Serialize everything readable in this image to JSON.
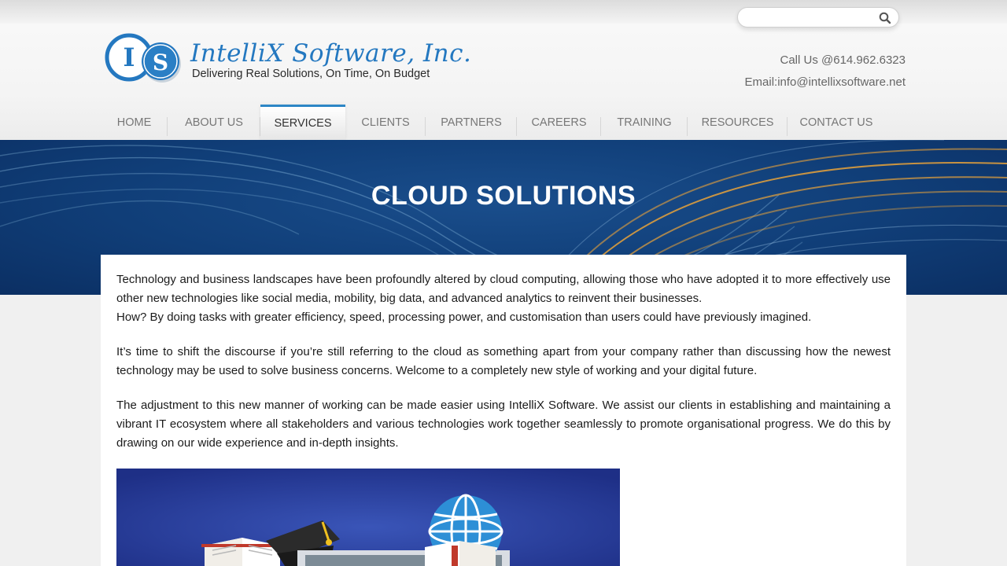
{
  "search": {
    "placeholder": "",
    "value": "",
    "icon": "search-icon"
  },
  "brand": {
    "logo_letters": [
      "I",
      "S"
    ],
    "name": "IntelliX Software, Inc.",
    "tagline": "Delivering Real Solutions, On Time, On Budget"
  },
  "contact": {
    "phone": "Call Us @614.962.6323",
    "email": "Email:info@intellixsoftware.net"
  },
  "nav": {
    "items": [
      {
        "label": "HOME"
      },
      {
        "label": "ABOUT US"
      },
      {
        "label": "SERVICES",
        "active": true
      },
      {
        "label": "CLIENTS"
      },
      {
        "label": "PARTNERS"
      },
      {
        "label": "CAREERS"
      },
      {
        "label": "TRAINING"
      },
      {
        "label": "RESOURCES"
      },
      {
        "label": "CONTACT US"
      }
    ]
  },
  "banner": {
    "title": "CLOUD SOLUTIONS"
  },
  "content": {
    "para1": {
      "text": "Technology and business landscapes have been profoundly altered by cloud computing, allowing those who have adopted it to more effectively use other new technologies like social media, mobility, big data, and advanced analytics to reinvent their businesses.",
      "text2": "How? By doing tasks with greater efficiency, speed, processing power, and customisation than users could have previously imagined."
    },
    "para2": "It’s time to shift the discourse if you’re still referring to the cloud as something apart from your company rather than discussing how the newest technology may be used to solve business concerns. Welcome to a completely new style of working and your digital future.",
    "para3": "The adjustment to this new manner of working can be made easier using IntelliX Software. We assist our clients in establishing and maintaining a vibrant IT ecosystem where all stakeholders and various technologies work together seamlessly to promote organisational progress. We do this by drawing on our wide experience and in-depth insights."
  },
  "colors": {
    "brand_blue": "#2478c0",
    "nav_active_border": "#2d86c6",
    "banner_bg": "#103e78",
    "banner_swoosh": "#e8a23a"
  }
}
